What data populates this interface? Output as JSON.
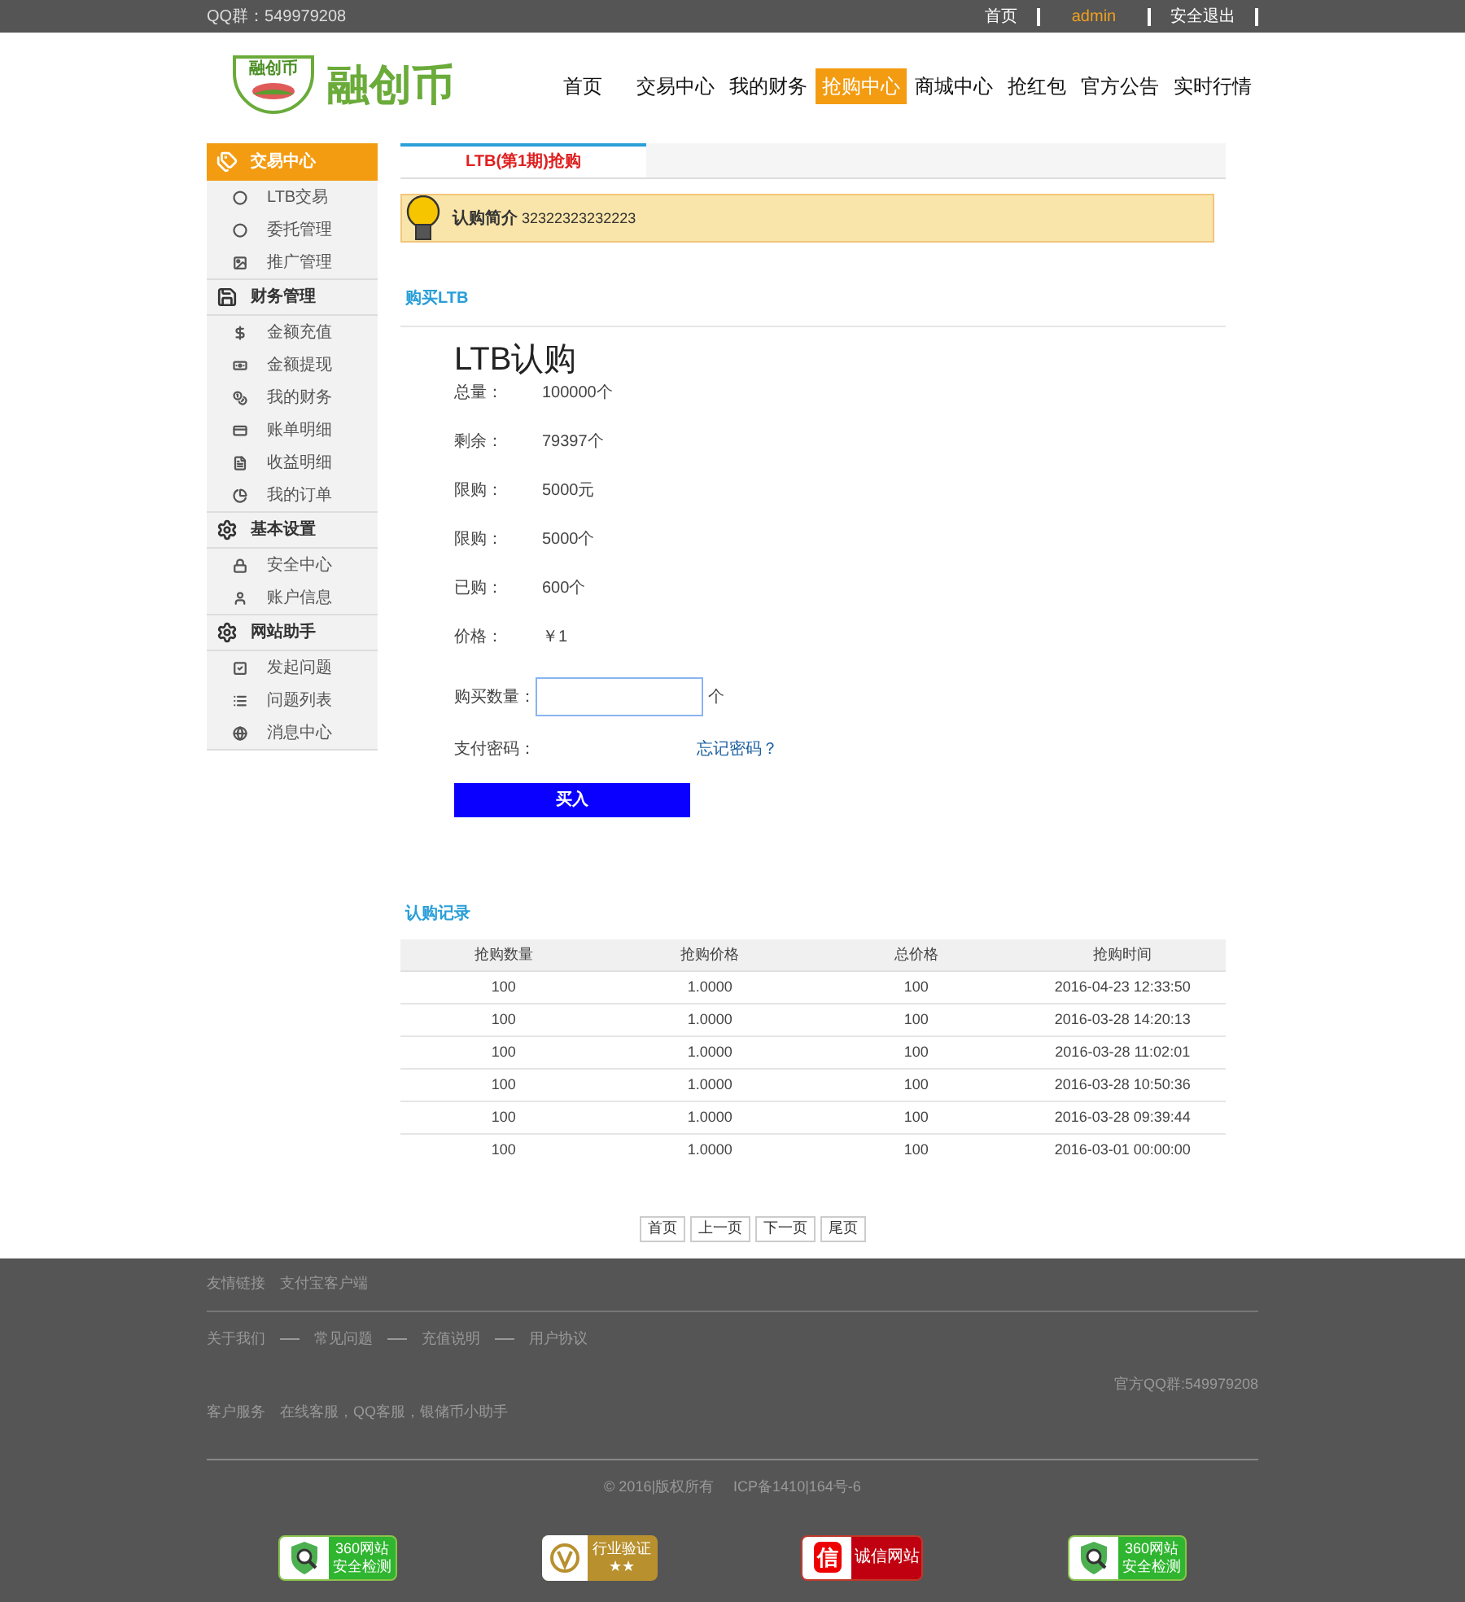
{
  "topbar": {
    "qq": "QQ群：549979208",
    "links": [
      {
        "label": "首页",
        "kind": "link"
      },
      {
        "label": "admin",
        "kind": "user"
      },
      {
        "label": "安全退出",
        "kind": "link"
      }
    ]
  },
  "header": {
    "logo_badge": "融创币",
    "logo_text": "融创币",
    "nav": [
      {
        "label": "首页",
        "selected": false
      },
      {
        "label": "交易中心",
        "selected": false
      },
      {
        "label": "我的财务",
        "selected": false
      },
      {
        "label": "抢购中心",
        "selected": true
      },
      {
        "label": "商城中心",
        "selected": false
      },
      {
        "label": "抢红包",
        "selected": false
      },
      {
        "label": "官方公告",
        "selected": false
      },
      {
        "label": "实时行情",
        "selected": false
      }
    ]
  },
  "sidebar": [
    {
      "title": "交易中心",
      "selected": true,
      "items": [
        "LTB交易",
        "委托管理",
        "推广管理"
      ]
    },
    {
      "title": "财务管理",
      "selected": false,
      "items": [
        "金额充值",
        "金额提现",
        "我的财务",
        "账单明细",
        "收益明细",
        "我的订单"
      ]
    },
    {
      "title": "基本设置",
      "selected": false,
      "items": [
        "安全中心",
        "账户信息"
      ]
    },
    {
      "title": "网站助手",
      "selected": false,
      "items": [
        "发起问题",
        "问题列表",
        "消息中心"
      ]
    }
  ],
  "tabs": [
    {
      "label": "LTB(第1期)抢购",
      "selected": true
    }
  ],
  "notice": {
    "label": "认购简介",
    "text": "32322323232223"
  },
  "buy": {
    "section_title": "购买LTB",
    "title": "LTB认购",
    "rows": [
      {
        "kind": "info",
        "label": "总量：",
        "value": "100000个"
      },
      {
        "kind": "info",
        "label": "剩余：",
        "value": "79397个"
      },
      {
        "kind": "info",
        "label": "限购：",
        "value": "5000元"
      },
      {
        "kind": "info",
        "label": "限购：",
        "value": "5000个"
      },
      {
        "kind": "info",
        "label": "已购：",
        "value": "600个"
      },
      {
        "kind": "info",
        "label": "价格：",
        "value": "￥1"
      },
      {
        "kind": "quantity",
        "label": "购买数量：",
        "unit": "个"
      },
      {
        "kind": "password",
        "label": "支付密码：",
        "link": "忘记密码？"
      }
    ],
    "button": "买入"
  },
  "records": {
    "title": "认购记录",
    "columns": [
      "抢购数量",
      "抢购价格",
      "总价格",
      "抢购时间"
    ],
    "rows": [
      [
        "100",
        "1.0000",
        "100",
        "2016-04-23 12:33:50"
      ],
      [
        "100",
        "1.0000",
        "100",
        "2016-03-28 14:20:13"
      ],
      [
        "100",
        "1.0000",
        "100",
        "2016-03-28 11:02:01"
      ],
      [
        "100",
        "1.0000",
        "100",
        "2016-03-28 10:50:36"
      ],
      [
        "100",
        "1.0000",
        "100",
        "2016-03-28 09:39:44"
      ],
      [
        "100",
        "1.0000",
        "100",
        "2016-03-01 00:00:00"
      ]
    ]
  },
  "pagination": [
    "首页",
    "上一页",
    "下一页",
    "尾页"
  ],
  "footer": {
    "friends_label": "友情链接",
    "friends": [
      "支付宝客户端"
    ],
    "about": [
      "关于我们",
      "常见问题",
      "充值说明",
      "用户协议"
    ],
    "qq": "官方QQ群:549979208",
    "service_label": "客户服务",
    "service": "在线客服，QQ客服，银储币小助手",
    "copyright": "© 2016|版权所有",
    "icp": "ICP备1410|164号-6",
    "badges": [
      {
        "kind": "security",
        "lines": [
          "360网站",
          "安全检测"
        ]
      },
      {
        "kind": "industry",
        "lines": [
          "行业验证",
          "★★"
        ]
      },
      {
        "kind": "credit",
        "glyph": "信",
        "lines": [
          "诚信网站"
        ]
      },
      {
        "kind": "security",
        "lines": [
          "360网站",
          "安全检测"
        ]
      }
    ]
  }
}
